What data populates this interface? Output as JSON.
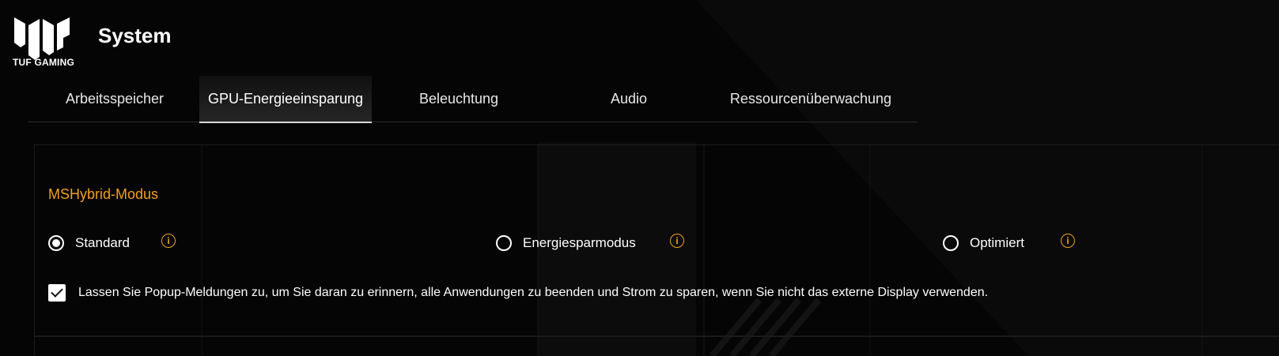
{
  "header": {
    "logo_text": "TUF GAMING",
    "title": "System"
  },
  "tabs": [
    {
      "label": "Arbeitsspeicher",
      "active": false
    },
    {
      "label": "GPU-Energieeinsparung",
      "active": true
    },
    {
      "label": "Beleuchtung",
      "active": false
    },
    {
      "label": "Audio",
      "active": false
    },
    {
      "label": "Ressourcenüberwachung",
      "active": false
    }
  ],
  "section": {
    "title": "MSHybrid-Modus",
    "options": [
      {
        "label": "Standard",
        "selected": true
      },
      {
        "label": "Energiesparmodus",
        "selected": false
      },
      {
        "label": "Optimiert",
        "selected": false
      }
    ],
    "info_glyph": "i",
    "popup_checkbox": {
      "checked": true,
      "label": "Lassen Sie Popup-Meldungen zu, um Sie daran zu erinnern, alle Anwendungen zu beenden und Strom zu sparen, wenn Sie nicht das externe Display verwenden."
    }
  },
  "colors": {
    "accent": "#f0a020",
    "background": "#050505",
    "text": "#ffffff"
  },
  "icons": {
    "logo": "tuf-logo-icon",
    "info": "info-icon",
    "check": "check-icon"
  }
}
